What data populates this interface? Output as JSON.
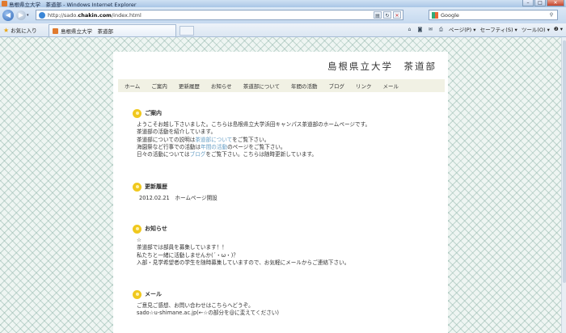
{
  "browser": {
    "window_title": "島根県立大学　茶道部 - Windows Internet Explorer",
    "url": "http://sado.",
    "url_domain": "chakin.com",
    "url_rest": "/index.html",
    "search_text": "Google",
    "favorites_label": "お気に入り",
    "tab_title": "島根県立大学　茶道部",
    "commands": [
      "ページ(P) ▾",
      "セーフティ(S) ▾",
      "ツール(O) ▾",
      "❷ ▾"
    ]
  },
  "site": {
    "title": "島根県立大学　茶道部",
    "menu": [
      "ホーム",
      "ご案内",
      "更新履歴",
      "お知らせ",
      "茶道部について",
      "年間の活動",
      "ブログ",
      "リンク",
      "メール"
    ]
  },
  "sections": {
    "guide": {
      "title": "ご案内",
      "line1": "ようこそお越し下さいました。こちらは島根県立大学浜田キャンパス茶道部のホームページです。",
      "line2": "茶道部の活動を紹介しています。",
      "line3_pre": "茶道部についての説明は",
      "line3_link": "茶道部について",
      "line3_post": "をご覧下さい。",
      "line4_pre": "海園祭など行事での活動は",
      "line4_link": "年間の活動",
      "line4_post": "のページをご覧下さい。",
      "line5_pre": "日々の活動については",
      "line5_link": "ブログ",
      "line5_post": "をご覧下さい。こちらは随時更新しています。"
    },
    "history": {
      "title": "更新履歴",
      "entry": "2012.02.21　ホームページ開設"
    },
    "news": {
      "title": "お知らせ",
      "line1": "☆",
      "line2": "茶道部では部員を募集しています！！",
      "line3": "私たちと一緒に活動しませんか(´・ω・)？",
      "line4": "入部・見学希望者の学生を随時募集していますので、お気軽にメールからご連絡下さい。"
    },
    "mail": {
      "title": "メール",
      "line1": "ご意見ご感想、お問い合わせはこちらへどうぞ。",
      "line2": "sado☆u-shimane.ac.jp(←☆の部分を@に変えてください)"
    }
  }
}
